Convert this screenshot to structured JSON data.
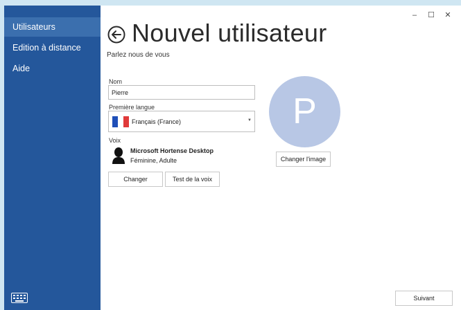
{
  "sidebar": {
    "items": [
      {
        "label": "Utilisateurs"
      },
      {
        "label": "Edition à distance"
      },
      {
        "label": "Aide"
      }
    ]
  },
  "titlebar": {
    "minimize": "–",
    "maximize": "☐",
    "close": "✕"
  },
  "header": {
    "title": "Nouvel utilisateur",
    "subtitle": "Parlez nous de vous"
  },
  "form": {
    "name_label": "Nom",
    "name_value": "Pierre",
    "language_label": "Première langue",
    "language_value": "Français (France)",
    "voice_label": "Voix",
    "voice_name": "Microsoft Hortense Desktop",
    "voice_desc": "Féminine, Adulte",
    "change_button": "Changer",
    "test_voice_button": "Test de la voix"
  },
  "avatar": {
    "letter": "P",
    "change_image_button": "Changer l'image",
    "color": "#b8c7e5"
  },
  "footer": {
    "next_button": "Suivant"
  },
  "colors": {
    "sidebar": "#24579b",
    "sidebar_active": "#3b6fae",
    "flag_blue": "#1f4fb8",
    "flag_red": "#e03a3a"
  }
}
